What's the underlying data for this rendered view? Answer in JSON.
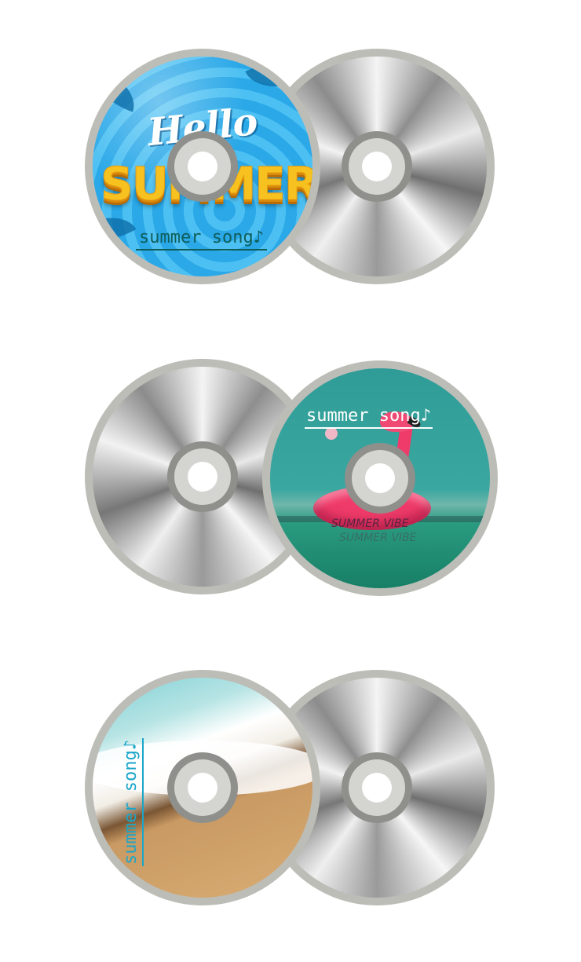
{
  "pairs": [
    {
      "label_disc": {
        "theme": "pool",
        "hello_text": "Hello",
        "headline": "SUMMER",
        "song_title": "summer song♪"
      },
      "colors": {
        "rim": "#bdbdb8",
        "text": "#0f5e5a",
        "accent": "#f7c21f"
      }
    },
    {
      "label_disc": {
        "theme": "flamingo-sea",
        "song_title": "summer song♪",
        "caption": "SUMMER VIBE",
        "caption_reflection": "SUMMER VIBE"
      },
      "colors": {
        "rim": "#bdbdb8",
        "text": "#ffffff",
        "accent": "#ef3b6a"
      }
    },
    {
      "label_disc": {
        "theme": "beach",
        "song_title": "summer song♪"
      },
      "colors": {
        "rim": "#bdbdb8",
        "text": "#1aa6c9"
      }
    }
  ]
}
